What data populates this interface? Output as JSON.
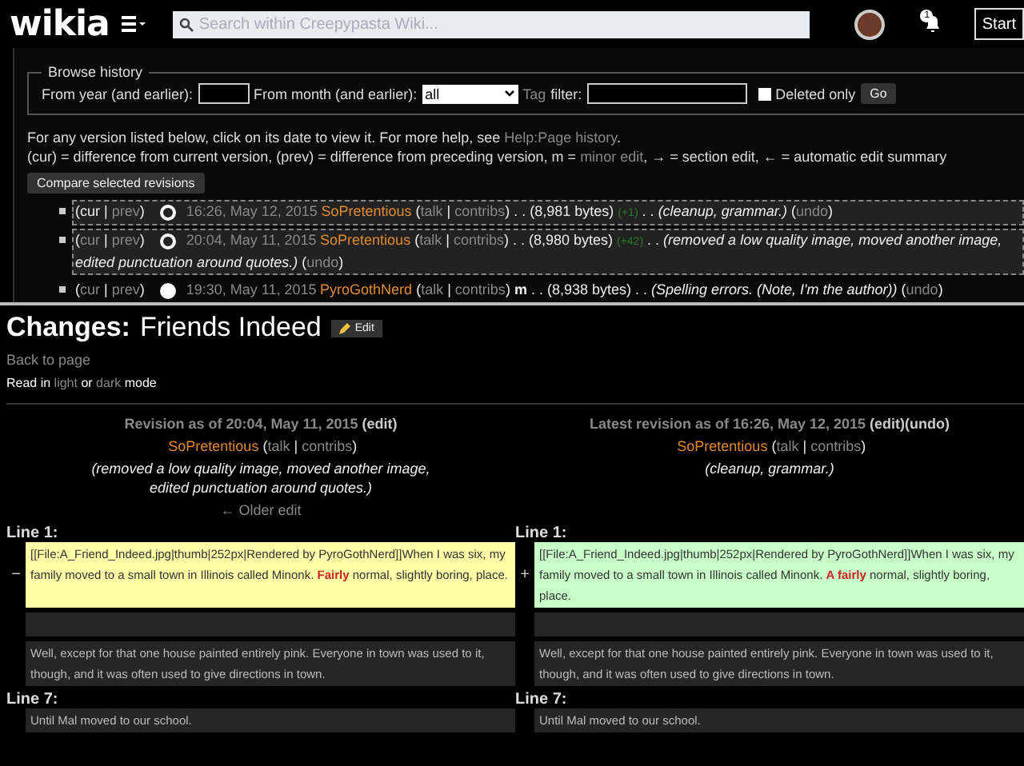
{
  "topbar": {
    "logo": "wikia",
    "search_placeholder": "Search within Creepypasta Wiki...",
    "start": "Start",
    "notifications": "1"
  },
  "browse_history": {
    "legend": "Browse history",
    "year_label": "From year (and earlier):",
    "month_label": "From month (and earlier):",
    "month_value": "all",
    "tag_link": "Tag",
    "tag_label": "filter:",
    "deleted_label": "Deleted only",
    "deleted_checked": false,
    "go": "Go"
  },
  "help_lines": [
    [
      {
        "kind": "text",
        "text": "For any version listed below, click on its date to view it. For more help, see "
      },
      {
        "kind": "link",
        "text": "Help:Page history"
      },
      {
        "kind": "text",
        "text": "."
      }
    ],
    [
      {
        "kind": "text",
        "text": "(cur) = difference from current version, (prev) = difference from preceding version, m = "
      },
      {
        "kind": "link",
        "text": "minor edit"
      },
      {
        "kind": "text",
        "text": ", → = section edit, ← = automatic edit summary"
      }
    ]
  ],
  "compare_button": "Compare selected revisions",
  "history": [
    {
      "selected": true,
      "parts": [
        {
          "kind": "text",
          "text": "("
        },
        {
          "kind": "text",
          "text": "cur"
        },
        {
          "kind": "text",
          "text": " | "
        },
        {
          "kind": "link",
          "text": "prev"
        },
        {
          "kind": "text",
          "text": ")"
        },
        {
          "kind": "radio",
          "selected": true
        },
        {
          "kind": "link",
          "text": "16:26, May 12, 2015"
        },
        {
          "kind": "user",
          "text": "SoPretentious"
        },
        {
          "kind": "text",
          "text": " ("
        },
        {
          "kind": "link",
          "text": "talk"
        },
        {
          "kind": "text",
          "text": " | "
        },
        {
          "kind": "link",
          "text": "contribs"
        },
        {
          "kind": "text",
          "text": ") . . (8,981 bytes) "
        },
        {
          "kind": "added",
          "text": "(+1)"
        },
        {
          "kind": "text",
          "text": " . . "
        },
        {
          "kind": "summary",
          "text": "(cleanup, grammar.)"
        },
        {
          "kind": "text",
          "text": " ("
        },
        {
          "kind": "link",
          "text": "undo"
        },
        {
          "kind": "text",
          "text": ")"
        }
      ]
    },
    {
      "selected": true,
      "parts": [
        {
          "kind": "text",
          "text": "("
        },
        {
          "kind": "link",
          "text": "cur"
        },
        {
          "kind": "text",
          "text": " | "
        },
        {
          "kind": "link",
          "text": "prev"
        },
        {
          "kind": "text",
          "text": ")"
        },
        {
          "kind": "radio",
          "selected": true
        },
        {
          "kind": "link",
          "text": "20:04, May 11, 2015"
        },
        {
          "kind": "user",
          "text": "SoPretentious"
        },
        {
          "kind": "text",
          "text": " ("
        },
        {
          "kind": "link",
          "text": "talk"
        },
        {
          "kind": "text",
          "text": " | "
        },
        {
          "kind": "link",
          "text": "contribs"
        },
        {
          "kind": "text",
          "text": ") . . (8,980 bytes) "
        },
        {
          "kind": "added",
          "text": "(+42)"
        },
        {
          "kind": "text",
          "text": " . . "
        },
        {
          "kind": "summary",
          "text": "(removed a low quality image, moved another image,"
        },
        {
          "kind": "break"
        },
        {
          "kind": "summary",
          "text": "edited punctuation around quotes.)"
        },
        {
          "kind": "text",
          "text": " ("
        },
        {
          "kind": "link",
          "text": "undo"
        },
        {
          "kind": "text",
          "text": ")"
        }
      ]
    },
    {
      "selected": false,
      "parts": [
        {
          "kind": "text",
          "text": "("
        },
        {
          "kind": "link",
          "text": "cur"
        },
        {
          "kind": "text",
          "text": " | "
        },
        {
          "kind": "link",
          "text": "prev"
        },
        {
          "kind": "text",
          "text": ")"
        },
        {
          "kind": "radio",
          "selected": false
        },
        {
          "kind": "link",
          "text": "19:30, May 11, 2015"
        },
        {
          "kind": "user",
          "text": "PyroGothNerd"
        },
        {
          "kind": "text",
          "text": " ("
        },
        {
          "kind": "link",
          "text": "talk"
        },
        {
          "kind": "text",
          "text": " | "
        },
        {
          "kind": "link",
          "text": "contribs"
        },
        {
          "kind": "text",
          "text": ") "
        },
        {
          "kind": "bold",
          "text": "m"
        },
        {
          "kind": "text",
          "text": " . . (8,938 bytes) . . "
        },
        {
          "kind": "summary",
          "text": "(Spelling errors. (Note, I'm the author))"
        },
        {
          "kind": "text",
          "text": " ("
        },
        {
          "kind": "link",
          "text": "undo"
        },
        {
          "kind": "text",
          "text": ")"
        }
      ]
    }
  ],
  "diff_page": {
    "title_prefix": "Changes:",
    "title": "Friends Indeed",
    "edit_button": "Edit",
    "back_link": "Back to page",
    "read_mode": [
      {
        "kind": "text",
        "text": "Read in "
      },
      {
        "kind": "link",
        "text": "light"
      },
      {
        "kind": "text",
        "text": " or "
      },
      {
        "kind": "link",
        "text": "dark"
      },
      {
        "kind": "text",
        "text": " mode"
      }
    ],
    "columns": [
      {
        "lines": [
          [
            {
              "kind": "heading",
              "text": "Revision as of 20:04, May 11, 2015 "
            },
            {
              "kind": "headlink",
              "text": "(edit)"
            }
          ],
          [
            {
              "kind": "user",
              "text": "SoPretentious"
            },
            {
              "kind": "text",
              "text": " ("
            },
            {
              "kind": "link",
              "text": "talk"
            },
            {
              "kind": "text",
              "text": " | "
            },
            {
              "kind": "link",
              "text": "contribs"
            },
            {
              "kind": "text",
              "text": ")"
            }
          ],
          [
            {
              "kind": "summary",
              "text": "(removed a low quality image, moved another image, edited punctuation around quotes.)"
            }
          ],
          [
            {
              "kind": "link",
              "text": "← Older edit"
            }
          ]
        ]
      },
      {
        "lines": [
          [
            {
              "kind": "heading",
              "text": "Latest revision as of 16:26, May 12, 2015 "
            },
            {
              "kind": "headlink",
              "text": "(edit)"
            },
            {
              "kind": "headlink",
              "text": "(undo)"
            }
          ],
          [
            {
              "kind": "user",
              "text": "SoPretentious"
            },
            {
              "kind": "text",
              "text": " ("
            },
            {
              "kind": "link",
              "text": "talk"
            },
            {
              "kind": "text",
              "text": " | "
            },
            {
              "kind": "link",
              "text": "contribs"
            },
            {
              "kind": "text",
              "text": ")"
            }
          ],
          [
            {
              "kind": "summary",
              "text": "(cleanup, grammar.)"
            }
          ]
        ]
      }
    ],
    "blocks": [
      {
        "line_left": "Line 1:",
        "line_right": "Line 1:",
        "rows": [
          {
            "kind": "change",
            "marker_left": "−",
            "marker_right": "+",
            "left": "[[File:A_Friend_Indeed.jpg|thumb|252px|Rendered by PyroGothNerd]]When I was six, my family moved to a small town in Illinois called Minonk. **Fairly** normal, slightly boring, place.",
            "right": "[[File:A_Friend_Indeed.jpg|thumb|252px|Rendered by PyroGothNerd]]When I was six, my family moved to a small town in Illinois called Minonk. **A fairly** normal, slightly boring, place."
          },
          {
            "kind": "empty"
          },
          {
            "kind": "context",
            "left": "Well, except for that one house painted entirely pink. Everyone in town was used to it, though, and it was often used to give directions in town.",
            "right": "Well, except for that one house painted entirely pink. Everyone in town was used to it, though, and it was often used to give directions in town."
          }
        ]
      },
      {
        "line_left": "Line 7:",
        "line_right": "Line 7:",
        "rows": [
          {
            "kind": "context",
            "left": "Until Mal moved to our school.",
            "right": "Until Mal moved to our school."
          }
        ]
      }
    ]
  }
}
